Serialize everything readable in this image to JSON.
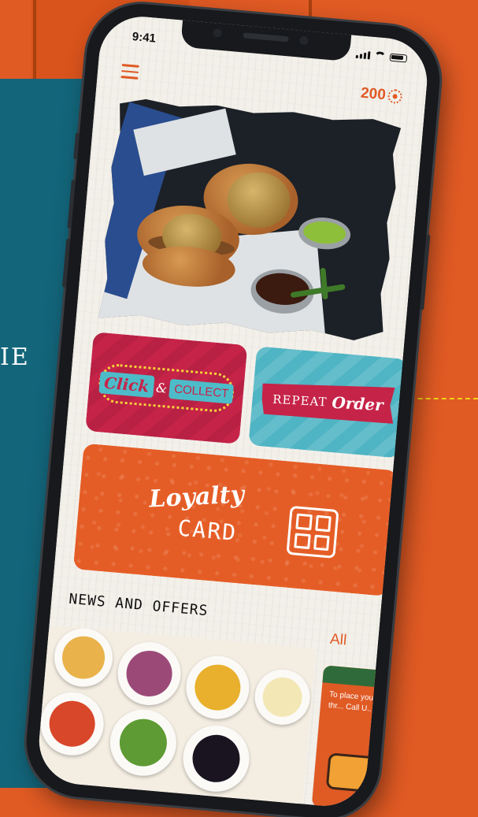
{
  "status_bar": {
    "time": "9:41"
  },
  "header": {
    "points": "200"
  },
  "side_text": "IE",
  "tiles": {
    "click_collect": {
      "word1": "Click",
      "amp": "&",
      "word2": "COLLECT"
    },
    "repeat_order": {
      "word1": "REPEAT",
      "word2": "Order"
    },
    "loyalty_card": {
      "word1": "Loyalty",
      "word2": "CARD"
    }
  },
  "news": {
    "title": "NEWS AND OFFERS",
    "all_label": "All",
    "promo_text": "To place you... Order thr... Call U..."
  },
  "colors": {
    "brand_orange": "#e05a24",
    "teal": "#13657a",
    "click_red": "#c62348",
    "repeat_teal": "#4fb4c3"
  },
  "icons": [
    "menu-icon",
    "points-icon",
    "signal-icon",
    "wifi-icon",
    "battery-icon",
    "qr-code-icon"
  ]
}
